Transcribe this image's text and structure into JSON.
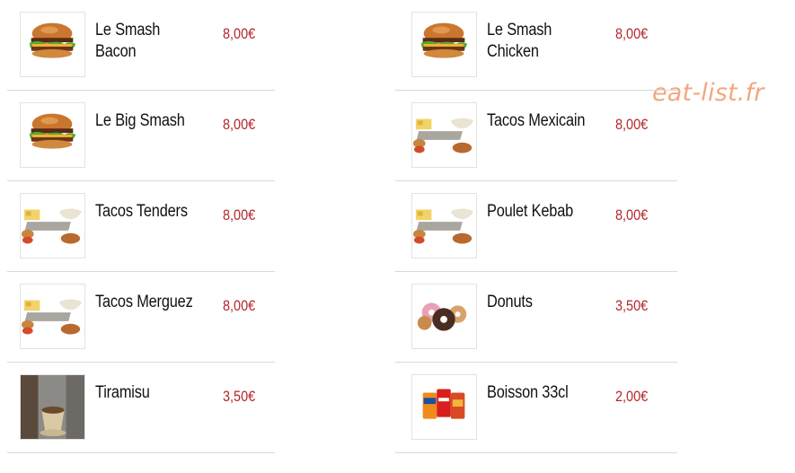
{
  "watermark": "eat-list.fr",
  "menu": {
    "left": [
      {
        "name": "Le Smash Bacon",
        "price": "8,00€",
        "image": "burger-image"
      },
      {
        "name": "Le Big Smash",
        "price": "8,00€",
        "image": "burger-image"
      },
      {
        "name": "Tacos Tenders",
        "price": "8,00€",
        "image": "tacos-image"
      },
      {
        "name": "Tacos Merguez",
        "price": "8,00€",
        "image": "tacos-image"
      },
      {
        "name": "Tiramisu",
        "price": "3,50€",
        "image": "tiramisu-image"
      }
    ],
    "right": [
      {
        "name": "Le Smash Chicken",
        "price": "8,00€",
        "image": "burger-image"
      },
      {
        "name": "Tacos Mexicain",
        "price": "8,00€",
        "image": "tacos-image"
      },
      {
        "name": "Poulet Kebab",
        "price": "8,00€",
        "image": "tacos-image"
      },
      {
        "name": "Donuts",
        "price": "3,50€",
        "image": "donuts-image"
      },
      {
        "name": "Boisson 33cl",
        "price": "2,00€",
        "image": "soda-cans-image"
      }
    ]
  }
}
